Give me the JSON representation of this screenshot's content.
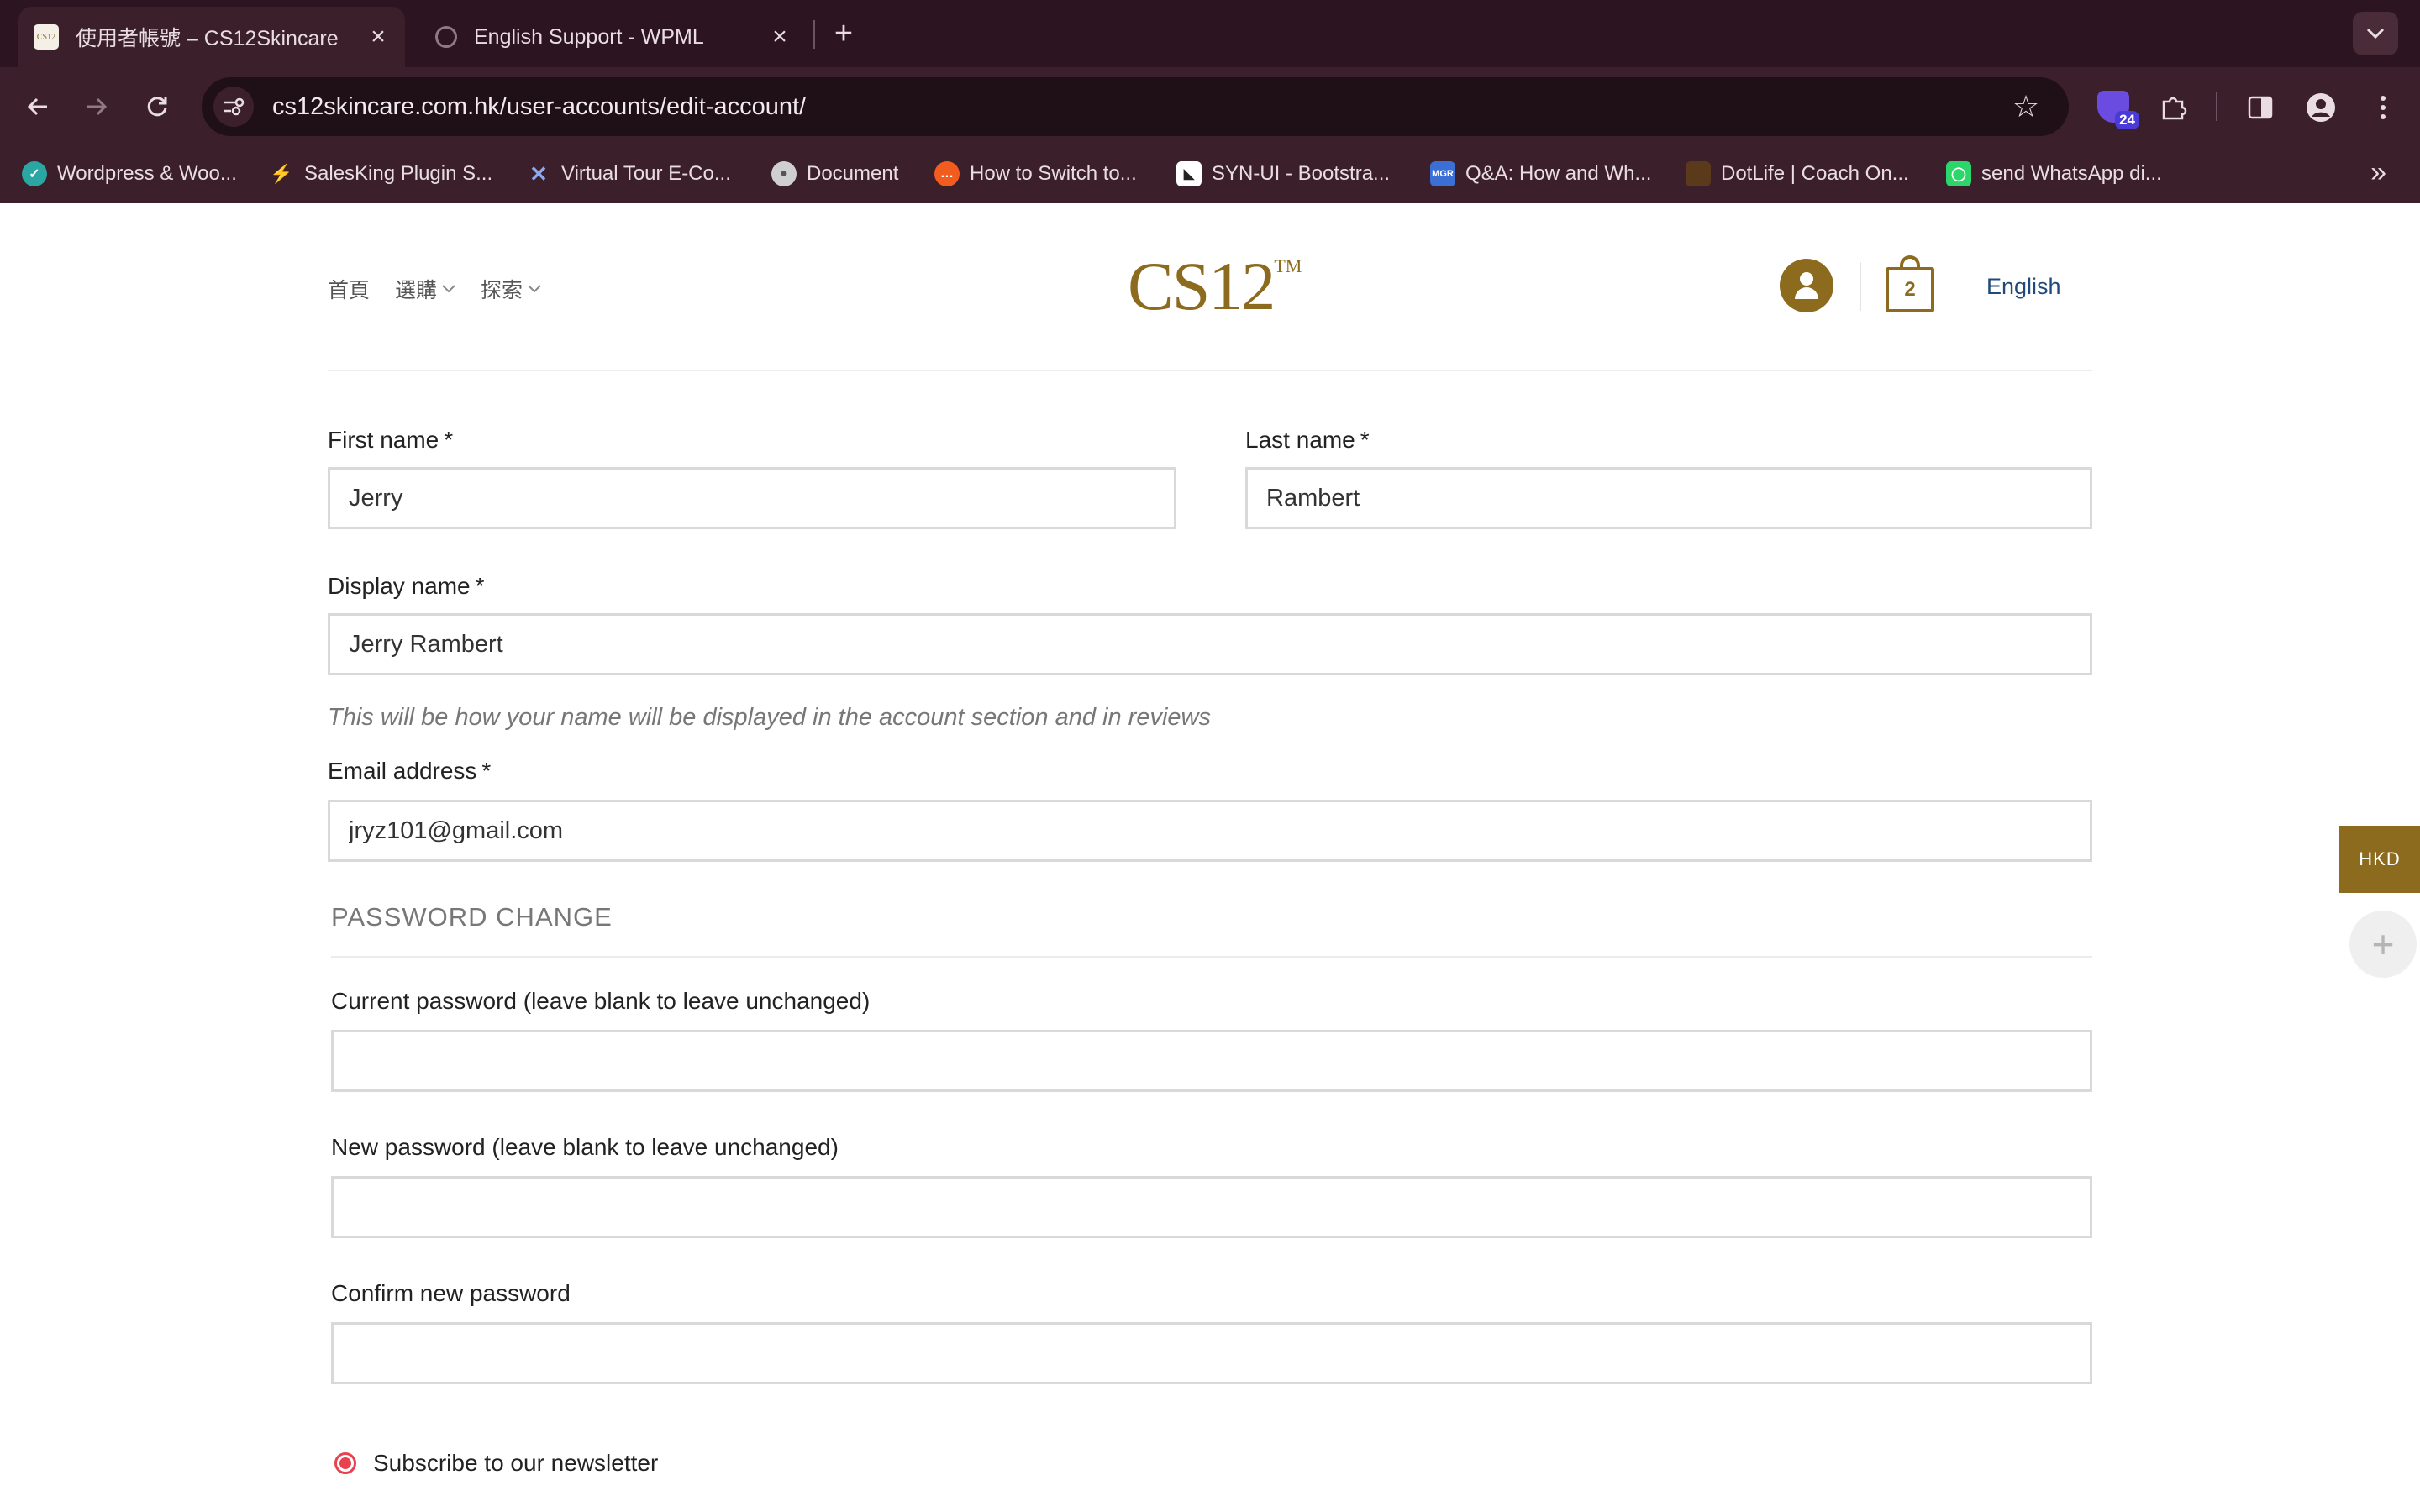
{
  "browser": {
    "tabs": [
      {
        "title": "使用者帳號 – CS12Skincare",
        "favicon": "CS12"
      },
      {
        "title": "English Support - WPML"
      }
    ],
    "url": "cs12skincare.com.hk/user-accounts/edit-account/",
    "extension_badge": "24",
    "bookmarks": [
      {
        "label": "Wordpress & Woo...",
        "color": "#2aa7a3"
      },
      {
        "label": "SalesKing Plugin S...",
        "color": "#333333"
      },
      {
        "label": "Virtual Tour E-Co...",
        "color": "#5b7bd5"
      },
      {
        "label": "Document",
        "color": "#777777"
      },
      {
        "label": "How to Switch to...",
        "color": "#f25c1e"
      },
      {
        "label": "SYN-UI - Bootstra...",
        "color": "#222222"
      },
      {
        "label": "Q&A: How and Wh...",
        "color": "#3b6fd6",
        "icon_text": "MGR"
      },
      {
        "label": "DotLife | Coach On...",
        "color": "#5a3a1a"
      },
      {
        "label": "send WhatsApp di...",
        "color": "#2bd66b"
      }
    ]
  },
  "header": {
    "nav": [
      {
        "label": "首頁",
        "has_dropdown": false
      },
      {
        "label": "選購",
        "has_dropdown": true
      },
      {
        "label": "探索",
        "has_dropdown": true
      }
    ],
    "logo_text": "CS12",
    "logo_tm": "TM",
    "cart_count": "2",
    "language": "English",
    "brand_color": "#8c6a1e"
  },
  "form": {
    "first_name": {
      "label": "First name",
      "required": "*",
      "value": "Jerry"
    },
    "last_name": {
      "label": "Last name",
      "required": "*",
      "value": "Rambert"
    },
    "display_name": {
      "label": "Display name",
      "required": "*",
      "value": "Jerry Rambert",
      "hint": "This will be how your name will be displayed in the account section and in reviews"
    },
    "email": {
      "label": "Email address",
      "required": "*",
      "value": "jryz101@gmail.com"
    },
    "password_section_title": "PASSWORD CHANGE",
    "current_password": {
      "label": "Current password (leave blank to leave unchanged)",
      "value": ""
    },
    "new_password": {
      "label": "New password (leave blank to leave unchanged)",
      "value": ""
    },
    "confirm_password": {
      "label": "Confirm new password",
      "value": ""
    },
    "newsletter": {
      "label": "Subscribe to our newsletter",
      "selected": true
    }
  },
  "side_widgets": {
    "currency": "HKD",
    "fab_icon": "plus-icon"
  }
}
